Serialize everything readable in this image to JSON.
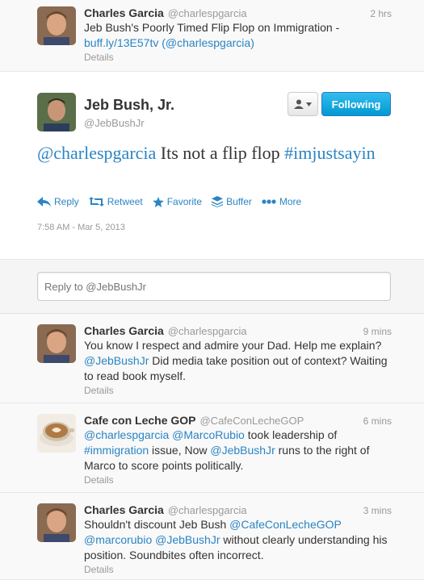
{
  "tweets_top": {
    "name": "Charles Garcia",
    "handle": "@charlespgarcia",
    "time": "2 hrs",
    "text_prefix": "Jeb Bush's Poorly Timed Flip Flop on Immigration - ",
    "link": "buff.ly/13E57tv",
    "mention": "(@charlespgarcia)",
    "details": "Details"
  },
  "main_tweet": {
    "name": "Jeb Bush, Jr.",
    "handle": "@JebBushJr",
    "follow_label": "Following",
    "mention": "@charlespgarcia",
    "text": " Its not a flip flop ",
    "hashtag": "#imjustsayin",
    "actions": {
      "reply": "Reply",
      "retweet": "Retweet",
      "favorite": "Favorite",
      "buffer": "Buffer",
      "more": "More"
    },
    "timestamp": "7:58 AM - Mar 5, 2013"
  },
  "reply_box": {
    "placeholder": "Reply to @JebBushJr"
  },
  "replies": [
    {
      "name": "Charles Garcia",
      "handle": "@charlespgarcia",
      "time": "9 mins",
      "line1": "You know I respect and admire your Dad. Help me explain?",
      "mention": "@JebBushJr",
      "line2": " Did media take position out of context? Waiting to read book myself.",
      "details": "Details"
    },
    {
      "name": "Cafe con Leche GOP",
      "handle": "@CafeConLecheGOP",
      "time": "6 mins",
      "m1": "@charlespgarcia",
      "m2": "@MarcoRubio",
      "t1": " took leadership of ",
      "h1": "#immigration",
      "t2": " issue, Now ",
      "m3": "@JebBushJr",
      "t3": " runs to the right of Marco to score points politically.",
      "details": "Details"
    },
    {
      "name": "Charles Garcia",
      "handle": "@charlespgarcia",
      "time": "3 mins",
      "t1": "Shouldn't discount Jeb Bush ",
      "m1": "@CafeConLecheGOP",
      "m2": "@marcorubio",
      "m3": "@JebBushJr",
      "t2": " without clearly understanding his position. Soundbites often incorrect.",
      "details": "Details"
    }
  ],
  "colors": {
    "link": "#2a85c4",
    "follow_button": "#019ad2"
  }
}
